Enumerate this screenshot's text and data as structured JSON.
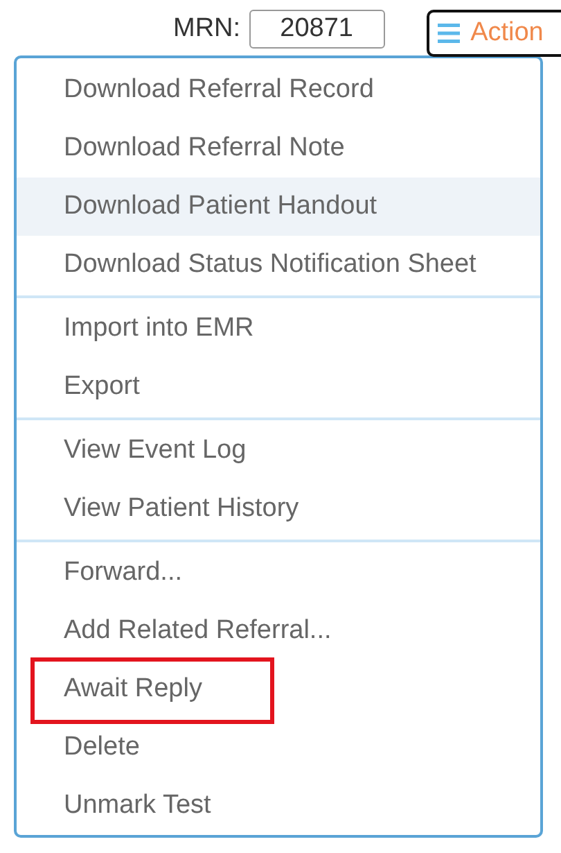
{
  "header": {
    "mrn_label": "MRN:",
    "mrn_value": "20871",
    "action_button": "Action"
  },
  "menu": {
    "groups": [
      [
        {
          "label": "Download Referral Record",
          "highlighted": false,
          "marked": false
        },
        {
          "label": "Download Referral Note",
          "highlighted": false,
          "marked": false
        },
        {
          "label": "Download Patient Handout",
          "highlighted": true,
          "marked": false
        },
        {
          "label": "Download Status Notification Sheet",
          "highlighted": false,
          "marked": false
        }
      ],
      [
        {
          "label": "Import into EMR",
          "highlighted": false,
          "marked": false
        },
        {
          "label": "Export",
          "highlighted": false,
          "marked": false
        }
      ],
      [
        {
          "label": "View Event Log",
          "highlighted": false,
          "marked": false
        },
        {
          "label": "View Patient History",
          "highlighted": false,
          "marked": false
        }
      ],
      [
        {
          "label": "Forward...",
          "highlighted": false,
          "marked": false
        },
        {
          "label": "Add Related Referral...",
          "highlighted": false,
          "marked": false
        },
        {
          "label": "Await Reply",
          "highlighted": false,
          "marked": true
        },
        {
          "label": "Delete",
          "highlighted": false,
          "marked": false
        },
        {
          "label": "Unmark Test",
          "highlighted": false,
          "marked": false
        }
      ]
    ]
  }
}
